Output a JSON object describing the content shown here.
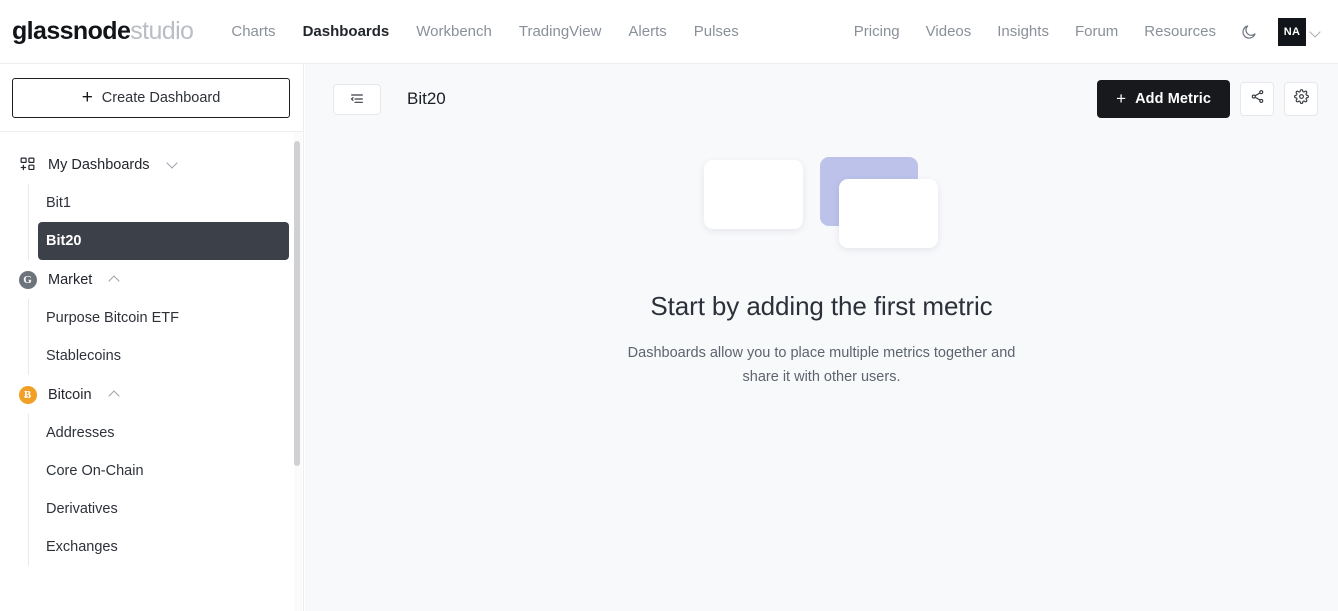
{
  "brand": {
    "name_bold": "glassnode",
    "name_light": "studio"
  },
  "topnav": {
    "left_items": [
      {
        "label": "Charts",
        "active": false
      },
      {
        "label": "Dashboards",
        "active": true
      },
      {
        "label": "Workbench",
        "active": false
      },
      {
        "label": "TradingView",
        "active": false
      },
      {
        "label": "Alerts",
        "active": false
      },
      {
        "label": "Pulses",
        "active": false
      }
    ],
    "right_items": [
      {
        "label": "Pricing"
      },
      {
        "label": "Videos"
      },
      {
        "label": "Insights"
      },
      {
        "label": "Forum"
      },
      {
        "label": "Resources"
      }
    ],
    "theme_toggle_icon": "moon-icon",
    "avatar_initials": "NA",
    "avatar_chevron_icon": "chevron-down-icon"
  },
  "sidebar": {
    "create_button": {
      "label": "Create Dashboard",
      "icon": "plus-icon"
    },
    "groups": [
      {
        "label": "My Dashboards",
        "icon": "dashboard-add-grid-icon",
        "caret": "chevron-down-icon",
        "expanded": true,
        "children": [
          {
            "label": "Bit1",
            "selected": false
          },
          {
            "label": "Bit20",
            "selected": true
          }
        ]
      },
      {
        "label": "Market",
        "icon": "market-circle-icon",
        "icon_glyph": "G",
        "icon_color": "#6e747c",
        "caret": "chevron-up-icon",
        "expanded": true,
        "children": [
          {
            "label": "Purpose Bitcoin ETF",
            "selected": false
          },
          {
            "label": "Stablecoins",
            "selected": false
          }
        ]
      },
      {
        "label": "Bitcoin",
        "icon": "bitcoin-circle-icon",
        "icon_glyph": "Ƀ",
        "icon_color": "#f2a025",
        "caret": "chevron-up-icon",
        "expanded": true,
        "children": [
          {
            "label": "Addresses",
            "selected": false
          },
          {
            "label": "Core On-Chain",
            "selected": false
          },
          {
            "label": "Derivatives",
            "selected": false
          },
          {
            "label": "Exchanges",
            "selected": false
          }
        ]
      }
    ]
  },
  "main": {
    "toggle_sidebar_icon": "sidebar-collapse-icon",
    "page_title": "Bit20",
    "add_metric": {
      "label": "Add Metric",
      "icon": "plus-icon"
    },
    "share_icon": "share-icon",
    "settings_icon": "gear-icon",
    "highlight_color": "#e02020",
    "empty_state": {
      "title": "Start by adding the first metric",
      "description": "Dashboards allow you to place multiple metrics together and share it with other users.",
      "accent_card_color": "#bcc2ea"
    }
  }
}
